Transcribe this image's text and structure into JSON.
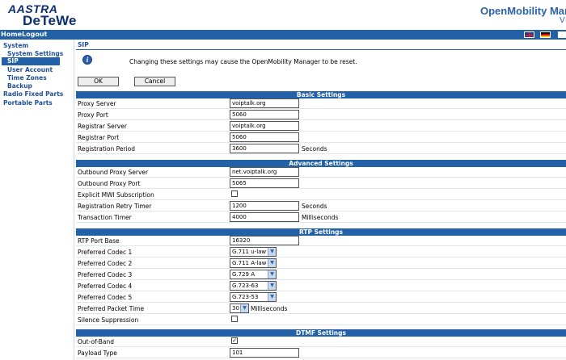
{
  "header": {
    "logo_line1": "AASTRA",
    "logo_line2": "DeTeWe",
    "product_title": "OpenMobility Man",
    "product_version": "V"
  },
  "topnav": {
    "home": "Home",
    "logout": "Logout"
  },
  "sidebar": {
    "items": [
      {
        "label": "System",
        "active": false
      },
      {
        "label": "System Settings",
        "active": false
      },
      {
        "label": "SIP",
        "active": true
      },
      {
        "label": "User Account",
        "active": false
      },
      {
        "label": "Time Zones",
        "active": false
      },
      {
        "label": "Backup",
        "active": false
      },
      {
        "label": "Radio Fixed Parts",
        "active": false
      },
      {
        "label": "Portable Parts",
        "active": false
      }
    ]
  },
  "page": {
    "title": "SIP",
    "warning": "Changing these settings may cause the OpenMobility Manager to be reset.",
    "ok": "OK",
    "cancel": "Cancel"
  },
  "basic": {
    "heading": "Basic Settings",
    "proxy_server": {
      "label": "Proxy Server",
      "value": "voiptalk.org"
    },
    "proxy_port": {
      "label": "Proxy Port",
      "value": "5060"
    },
    "registrar_server": {
      "label": "Registrar Server",
      "value": "voiptalk.org"
    },
    "registrar_port": {
      "label": "Registrar Port",
      "value": "5060"
    },
    "registration_period": {
      "label": "Registration Period",
      "value": "3600",
      "unit": "Seconds"
    }
  },
  "advanced": {
    "heading": "Advanced Settings",
    "outbound_proxy_server": {
      "label": "Outbound Proxy Server",
      "value": "net.voiptalk.org"
    },
    "outbound_proxy_port": {
      "label": "Outbound Proxy Port",
      "value": "5065"
    },
    "explicit_mwi": {
      "label": "Explicit MWI Subscription",
      "checked": false
    },
    "retry_timer": {
      "label": "Registration Retry Timer",
      "value": "1200",
      "unit": "Seconds"
    },
    "transaction_timer": {
      "label": "Transaction Timer",
      "value": "4000",
      "unit": "Milliseconds"
    }
  },
  "rtp": {
    "heading": "RTP Settings",
    "port_base": {
      "label": "RTP Port Base",
      "value": "16320"
    },
    "codec1": {
      "label": "Preferred Codec 1",
      "value": "G.711 u-law"
    },
    "codec2": {
      "label": "Preferred Codec 2",
      "value": "G.711 A-law"
    },
    "codec3": {
      "label": "Preferred Codec 3",
      "value": "G.729 A"
    },
    "codec4": {
      "label": "Preferred Codec 4",
      "value": "G.723-63"
    },
    "codec5": {
      "label": "Preferred Codec 5",
      "value": "G.723-53"
    },
    "packet_time": {
      "label": "Preferred Packet Time",
      "value": "30",
      "unit": "Milliseconds"
    },
    "silence": {
      "label": "Silence Suppression",
      "checked": false
    }
  },
  "dtmf": {
    "heading": "DTMF Settings",
    "out_of_band": {
      "label": "Out-of-Band",
      "checked": true,
      "mark": "✓"
    },
    "payload_type": {
      "label": "Payload Type",
      "value": "101"
    }
  }
}
